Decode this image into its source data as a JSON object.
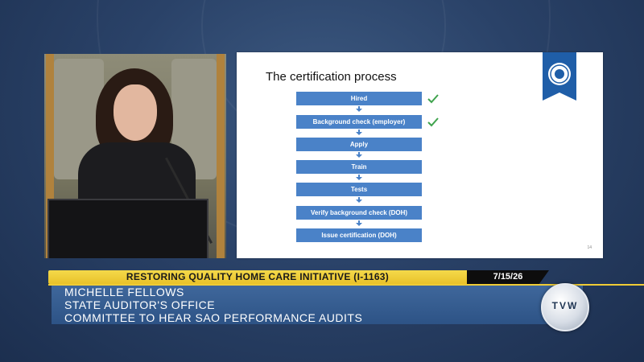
{
  "slide": {
    "title": "The certification process",
    "steps": [
      {
        "label": "Hired",
        "checked": true
      },
      {
        "label": "Background check (employer)",
        "checked": true
      },
      {
        "label": "Apply",
        "checked": false
      },
      {
        "label": "Train",
        "checked": false
      },
      {
        "label": "Tests",
        "checked": false
      },
      {
        "label": "Verify background check (DOH)",
        "checked": false
      },
      {
        "label": "Issue certification (DOH)",
        "checked": false
      }
    ],
    "page_number": "14",
    "step_color": "#4a82c8",
    "check_color": "#3fa34d"
  },
  "lower_third": {
    "ticker": "RESTORING QUALITY HOME CARE INITIATIVE (I-1163)",
    "date": "7/15/26",
    "name": "MICHELLE FELLOWS",
    "org": "STATE AUDITOR'S OFFICE",
    "committee": "COMMITTEE TO HEAR SAO PERFORMANCE AUDITS",
    "logo_text": "TVW"
  },
  "colors": {
    "ticker_yellow": "#e9c22a",
    "name_blue": "#2d5386",
    "background": "#2a4268"
  }
}
